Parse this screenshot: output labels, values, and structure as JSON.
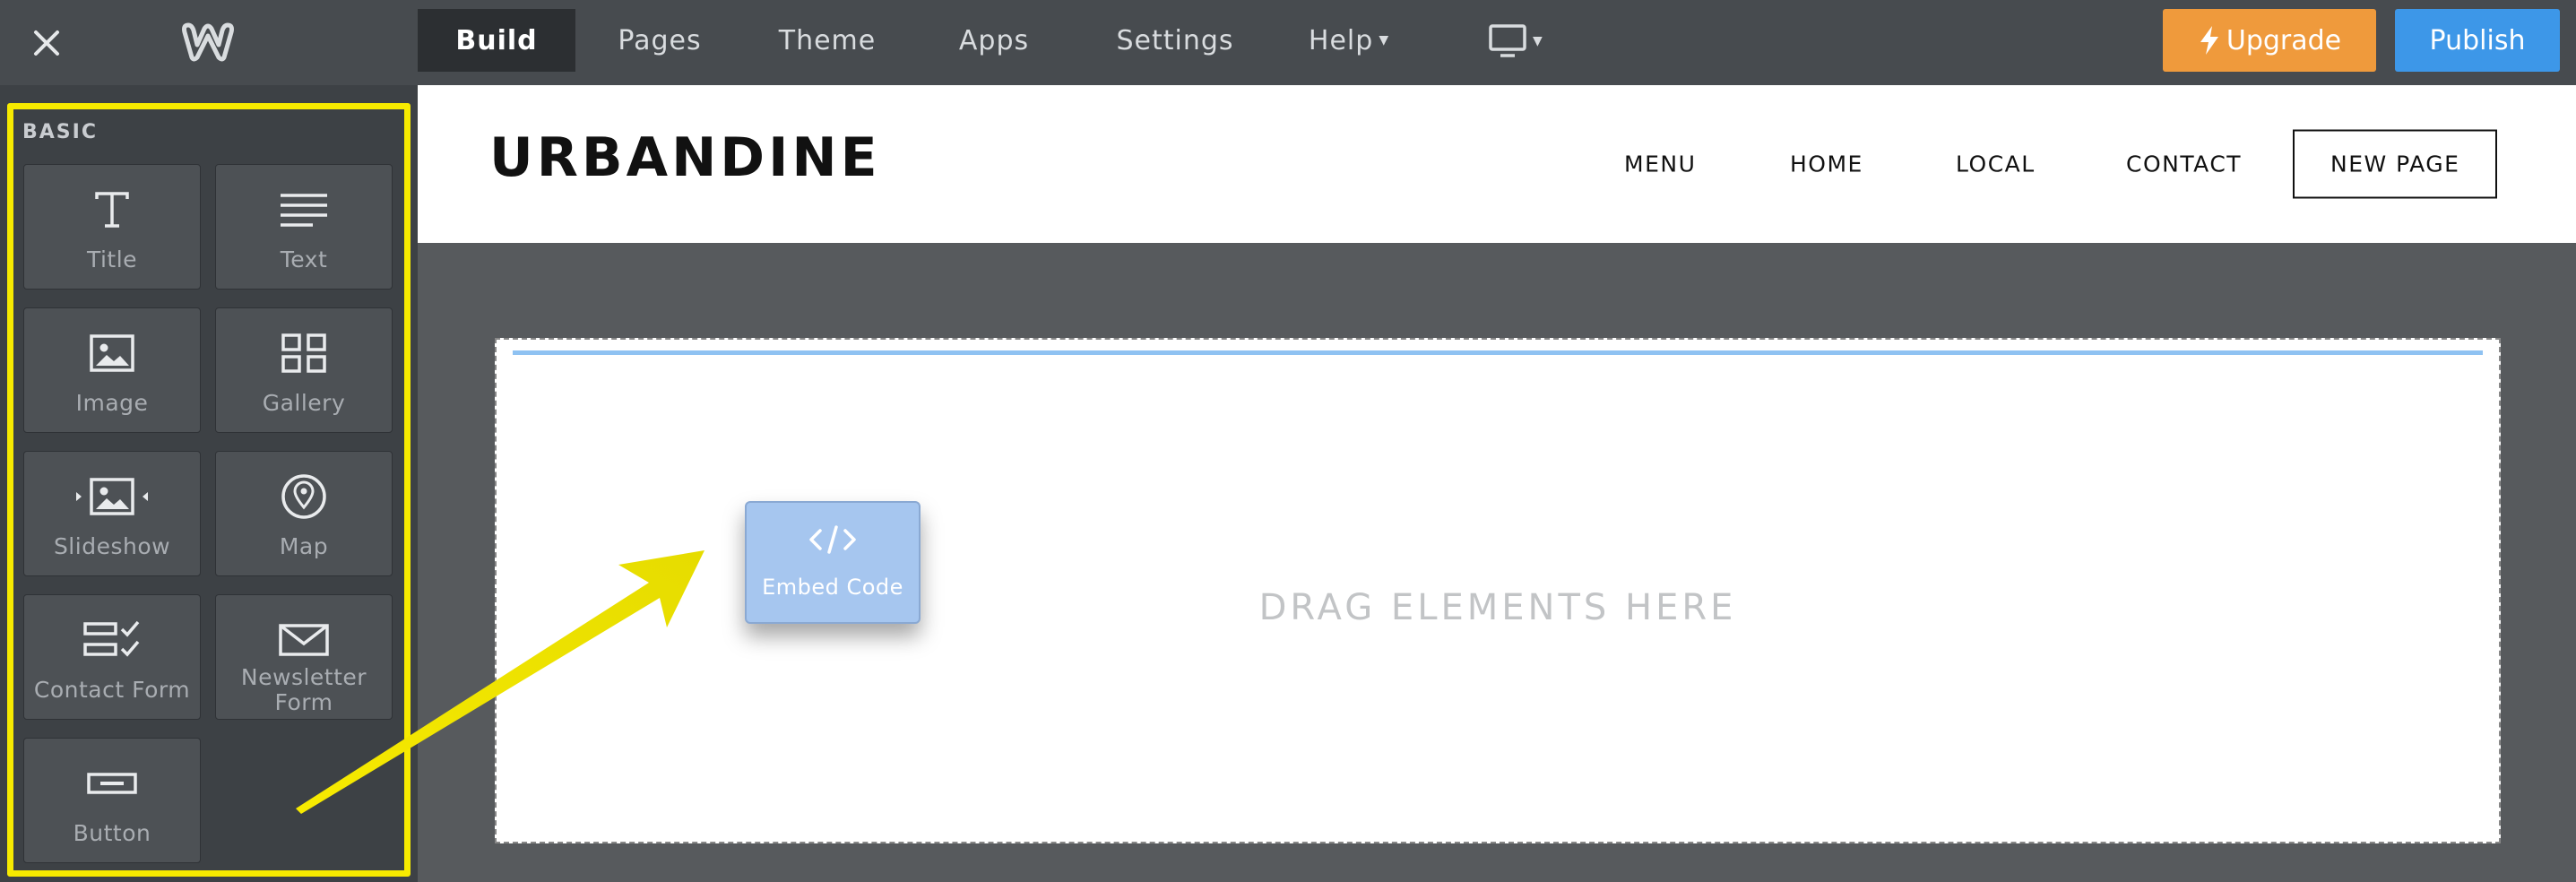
{
  "topbar": {
    "close_icon": "close-icon",
    "logo_icon": "weebly-logo-icon",
    "tabs": [
      {
        "label": "Build",
        "active": true
      },
      {
        "label": "Pages"
      },
      {
        "label": "Theme"
      },
      {
        "label": "Apps"
      },
      {
        "label": "Settings"
      },
      {
        "label": "Help",
        "has_dropdown": true
      }
    ],
    "device_icon": "desktop-icon",
    "upgrade_label": "Upgrade",
    "upgrade_icon": "lightning-icon",
    "publish_label": "Publish"
  },
  "sidebar": {
    "section_label": "BASIC",
    "highlight_color": "#f7ea00",
    "elements": [
      {
        "label": "Title",
        "icon": "title-icon"
      },
      {
        "label": "Text",
        "icon": "text-icon"
      },
      {
        "label": "Image",
        "icon": "image-icon"
      },
      {
        "label": "Gallery",
        "icon": "gallery-icon"
      },
      {
        "label": "Slideshow",
        "icon": "slideshow-icon"
      },
      {
        "label": "Map",
        "icon": "map-pin-icon"
      },
      {
        "label": "Contact Form",
        "icon": "contact-form-icon"
      },
      {
        "label": "Newsletter Form",
        "icon": "envelope-icon"
      },
      {
        "label": "Button",
        "icon": "button-icon"
      }
    ]
  },
  "site": {
    "title": "URBANDINE",
    "nav": [
      "MENU",
      "HOME",
      "LOCAL",
      "CONTACT",
      "NEW PAGE"
    ]
  },
  "canvas": {
    "drop_text": "DRAG ELEMENTS HERE",
    "dragging_element": {
      "label": "Embed Code",
      "icon": "code-icon"
    }
  },
  "colors": {
    "upgrade": "#ef9a3c",
    "publish": "#3d97e8",
    "drag_card": "#a6c6ef",
    "annotation_arrow": "#f7ea00"
  }
}
